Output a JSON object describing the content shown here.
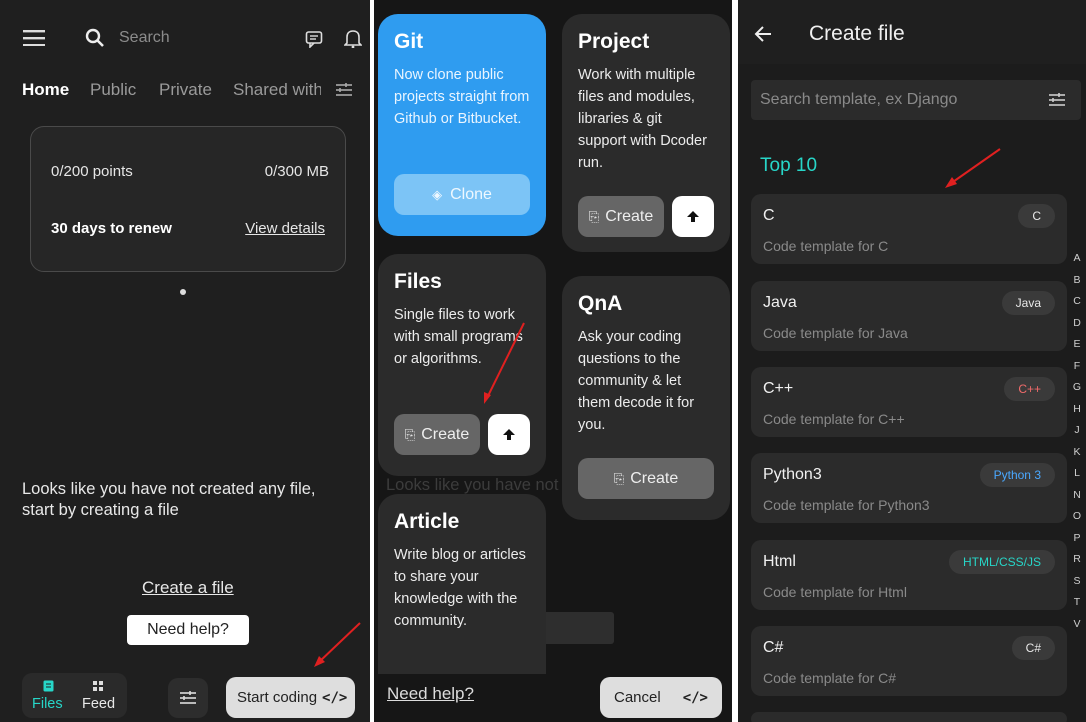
{
  "panel1": {
    "search_placeholder": "Search",
    "tabs": [
      "Home",
      "Public",
      "Private",
      "Shared with"
    ],
    "card": {
      "points": "0/200 points",
      "storage": "0/300 MB",
      "renew": "30 days to renew",
      "view_details": "View details"
    },
    "empty_message": "Looks like you have not created any file, start by creating a file",
    "create_file_link": "Create a file",
    "need_help_button": "Need help?",
    "bottom_nav": {
      "files": "Files",
      "feed": "Feed"
    },
    "start_coding_button": "Start coding",
    "code_glyph": "</>"
  },
  "panel2": {
    "git": {
      "title": "Git",
      "desc": "Now clone public projects straight from Github or Bitbucket.",
      "button": "Clone"
    },
    "project": {
      "title": "Project",
      "desc": "Work with multiple files and modules, libraries & git support with Dcoder run.",
      "button": "Create"
    },
    "files": {
      "title": "Files",
      "desc": "Single files to work with small programs or algorithms.",
      "button": "Create"
    },
    "qna": {
      "title": "QnA",
      "desc": "Ask your coding questions to the community & let them decode it for you.",
      "button": "Create"
    },
    "article": {
      "title": "Article",
      "desc": "Write blog or articles to share your knowledge with the community."
    },
    "need_help_link": "Need help?",
    "cancel_button": "Cancel",
    "code_glyph": "</>"
  },
  "panel3": {
    "title": "Create file",
    "search_placeholder": "Search template, ex Django",
    "section": "Top 10",
    "templates": [
      {
        "name": "C",
        "desc": "Code template for C",
        "badge": "C",
        "badge_color": "#e8e8e8"
      },
      {
        "name": "Java",
        "desc": "Code template for Java",
        "badge": "Java",
        "badge_color": "#e8e8e8"
      },
      {
        "name": "C++",
        "desc": "Code template for C++",
        "badge": "C++",
        "badge_color": "#f06b6b"
      },
      {
        "name": "Python3",
        "desc": "Code template for Python3",
        "badge": "Python 3",
        "badge_color": "#4aa8ff"
      },
      {
        "name": "Html",
        "desc": "Code template for Html",
        "badge": "HTML/CSS/JS",
        "badge_color": "#27d6c8"
      },
      {
        "name": "C#",
        "desc": "Code template for C#",
        "badge": "C#",
        "badge_color": "#e8e8e8"
      }
    ],
    "index_letters": [
      "A",
      "B",
      "C",
      "D",
      "E",
      "F",
      "G",
      "H",
      "J",
      "K",
      "L",
      "N",
      "O",
      "P",
      "R",
      "S",
      "T",
      "V"
    ]
  },
  "colors": {
    "accent_teal": "#27d6c8",
    "git_blue": "#2f9cf0",
    "annotation_red": "#e02020"
  }
}
